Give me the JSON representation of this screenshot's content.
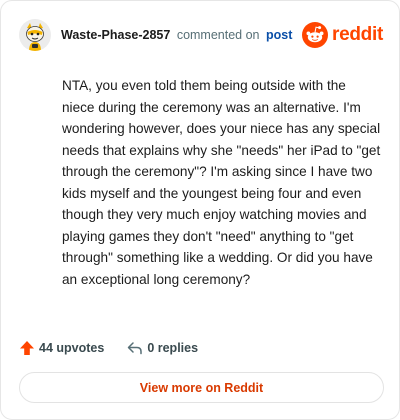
{
  "comment": {
    "username": "Waste-Phase-2857",
    "action_text": "commented on",
    "post_link": "post",
    "body": "NTA, you even told them being outside with the niece during the ceremony was an alternative. I'm wondering however, does your niece has any special needs that explains why she \"needs\" her iPad to \"get through the ceremony\"? I'm asking since I have two kids myself and the youngest being four and even though they very much enjoy watching movies and playing games they don't \"need\" anything to \"get through\" something like a wedding. Or did you have an exceptional long ceremony?"
  },
  "brand": {
    "wordmark": "reddit",
    "color": "#ff4500"
  },
  "stats": {
    "upvotes": "44 upvotes",
    "replies": "0 replies"
  },
  "footer": {
    "view_more_label": "View more on Reddit"
  },
  "icons": {
    "avatar": "snoo-avatar-icon",
    "logo": "reddit-snoo-logo-icon",
    "upvote": "upvote-arrow-icon",
    "reply": "reply-arrow-icon"
  }
}
